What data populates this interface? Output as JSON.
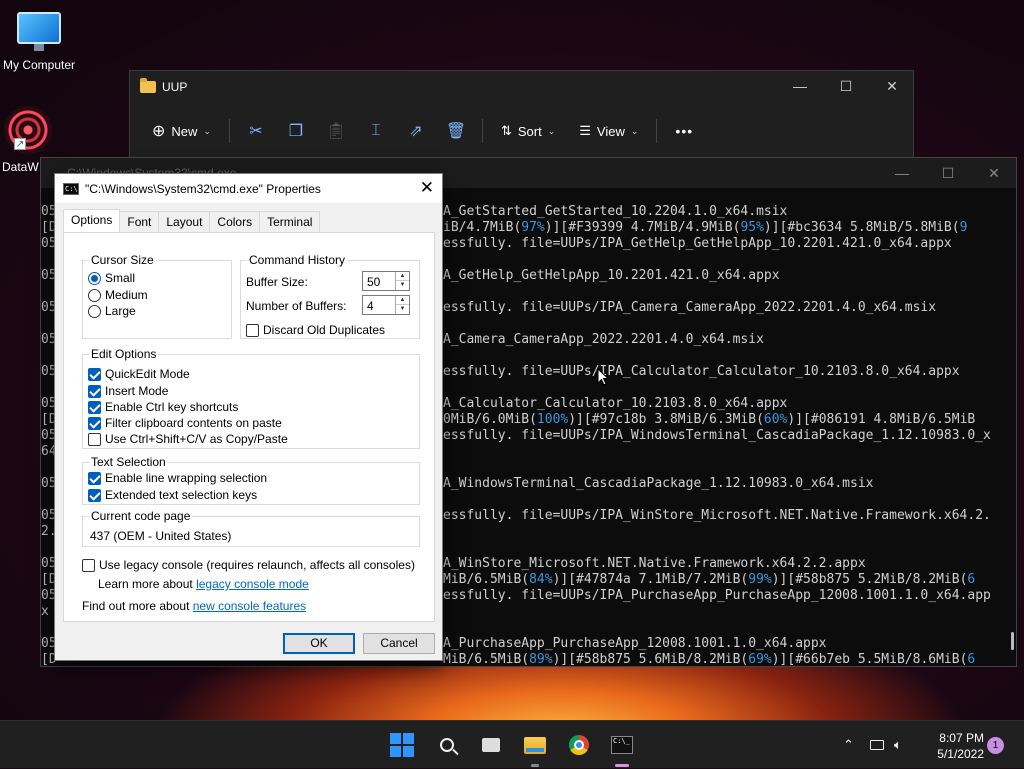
{
  "desktop": {
    "icons": [
      {
        "label": "My Computer",
        "icon": "monitor-icon"
      },
      {
        "label": "DataW",
        "icon": "datawave-icon"
      }
    ]
  },
  "explorer": {
    "title": "UUP",
    "toolbar": {
      "new_label": "New",
      "sort_label": "Sort",
      "view_label": "View",
      "icons": [
        "cut-icon",
        "copy-icon",
        "paste-icon",
        "rename-icon",
        "share-icon",
        "delete-icon"
      ],
      "more": "•••"
    }
  },
  "console": {
    "title": "C:\\Windows\\System32\\cmd.exe",
    "lines": [
      {
        "left": "05",
        "right": [
          {
            "t": "A_GetStarted_GetStarted_10.2204.1.0_x64.msix"
          }
        ]
      },
      {
        "left": "[D",
        "right": [
          {
            "t": "iB/4.7MiB("
          },
          {
            "t": "97%",
            "c": "cyan"
          },
          {
            "t": ")][#F39399 4.7MiB/4.9MiB("
          },
          {
            "t": "95%",
            "c": "cyan"
          },
          {
            "t": ")][#bc3634 5.8MiB/5.8MiB("
          },
          {
            "t": "9",
            "c": "cyan"
          }
        ]
      },
      {
        "left": "05",
        "right": [
          {
            "t": "essfully. file=UUPs/IPA_GetHelp_GetHelpApp_10.2201.421.0_x64.appx"
          }
        ]
      },
      {
        "left": "",
        "right": []
      },
      {
        "left": "05",
        "right": [
          {
            "t": "A_GetHelp_GetHelpApp_10.2201.421.0_x64.appx"
          }
        ]
      },
      {
        "left": "",
        "right": []
      },
      {
        "left": "05",
        "right": [
          {
            "t": "essfully. file=UUPs/IPA_Camera_CameraApp_2022.2201.4.0_x64.msix"
          }
        ]
      },
      {
        "left": "",
        "right": []
      },
      {
        "left": "05",
        "right": [
          {
            "t": "A_Camera_CameraApp_2022.2201.4.0_x64.msix"
          }
        ]
      },
      {
        "left": "",
        "right": []
      },
      {
        "left": "05",
        "right": [
          {
            "t": "essfully. file=UUPs/IPA_Calculator_Calculator_10.2103.8.0_x64.appx"
          }
        ]
      },
      {
        "left": "",
        "right": []
      },
      {
        "left": "05",
        "right": [
          {
            "t": "A_Calculator_Calculator_10.2103.8.0_x64.appx"
          }
        ]
      },
      {
        "left": "[D",
        "right": [
          {
            "t": "0MiB/6.0MiB("
          },
          {
            "t": "100%",
            "c": "cyan"
          },
          {
            "t": ")][#97c18b 3.8MiB/6.3MiB("
          },
          {
            "t": "60%",
            "c": "cyan"
          },
          {
            "t": ")][#086191 4.8MiB/6.5MiB"
          }
        ]
      },
      {
        "left": "05",
        "right": [
          {
            "t": "essfully. file=UUPs/IPA_WindowsTerminal_CascadiaPackage_1.12.10983.0_x"
          }
        ]
      },
      {
        "left": "64",
        "right": []
      },
      {
        "left": "",
        "right": []
      },
      {
        "left": "05",
        "right": [
          {
            "t": "A_WindowsTerminal_CascadiaPackage_1.12.10983.0_x64.msix"
          }
        ]
      },
      {
        "left": "",
        "right": []
      },
      {
        "left": "05",
        "right": [
          {
            "t": "essfully. file=UUPs/IPA_WinStore_Microsoft.NET.Native.Framework.x64.2."
          }
        ]
      },
      {
        "left": "2.",
        "right": []
      },
      {
        "left": "",
        "right": []
      },
      {
        "left": "05",
        "right": [
          {
            "t": "A_WinStore_Microsoft.NET.Native.Framework.x64.2.2.appx"
          }
        ]
      },
      {
        "left": "[D",
        "right": [
          {
            "t": "MiB/6.5MiB("
          },
          {
            "t": "84%",
            "c": "cyan"
          },
          {
            "t": ")][#47874a 7.1MiB/7.2MiB("
          },
          {
            "t": "99%",
            "c": "cyan"
          },
          {
            "t": ")][#58b875 5.2MiB/8.2MiB("
          },
          {
            "t": "6",
            "c": "cyan"
          }
        ]
      },
      {
        "left": "05",
        "right": [
          {
            "t": "essfully. file=UUPs/IPA_PurchaseApp_PurchaseApp_12008.1001.1.0_x64.app"
          }
        ]
      },
      {
        "left": "x",
        "right": []
      },
      {
        "left": "",
        "right": []
      },
      {
        "left": "05",
        "right": [
          {
            "t": "A_PurchaseApp_PurchaseApp_12008.1001.1.0_x64.appx"
          }
        ]
      },
      {
        "left": "[D",
        "right": [
          {
            "t": "MiB/6.5MiB("
          },
          {
            "t": "89%",
            "c": "cyan"
          },
          {
            "t": ")][#58b875 5.6MiB/8.2MiB("
          },
          {
            "t": "69%",
            "c": "cyan"
          },
          {
            "t": ")][#66b7eb 5.5MiB/8.6MiB("
          },
          {
            "t": "6",
            "c": "cyan"
          }
        ]
      }
    ]
  },
  "dialog": {
    "title": "\"C:\\Windows\\System32\\cmd.exe\" Properties",
    "tabs": [
      "Options",
      "Font",
      "Layout",
      "Colors",
      "Terminal"
    ],
    "cursor_size": {
      "legend": "Cursor Size",
      "options": [
        "Small",
        "Medium",
        "Large"
      ],
      "selected": "Small"
    },
    "command_history": {
      "legend": "Command History",
      "buffer_size_label": "Buffer Size:",
      "buffer_size": "50",
      "num_buffers_label": "Number of Buffers:",
      "num_buffers": "4",
      "discard_label": "Discard Old Duplicates"
    },
    "edit_options": {
      "legend": "Edit Options",
      "items": [
        {
          "label": "QuickEdit Mode",
          "checked": true
        },
        {
          "label": "Insert Mode",
          "checked": true
        },
        {
          "label": "Enable Ctrl key shortcuts",
          "checked": true
        },
        {
          "label": "Filter clipboard contents on paste",
          "checked": true
        },
        {
          "label": "Use Ctrl+Shift+C/V as Copy/Paste",
          "checked": false
        }
      ]
    },
    "text_selection": {
      "legend": "Text Selection",
      "items": [
        {
          "label": "Enable line wrapping selection",
          "checked": true
        },
        {
          "label": "Extended text selection keys",
          "checked": true
        }
      ]
    },
    "code_page": {
      "legend": "Current code page",
      "value": "437   (OEM - United States)"
    },
    "legacy_label": "Use legacy console (requires relaunch, affects all consoles)",
    "learn_more_prefix": "Learn more about ",
    "learn_more_link": "legacy console mode",
    "find_out_prefix": "Find out more about ",
    "find_out_link": "new console features",
    "ok_label": "OK",
    "cancel_label": "Cancel"
  },
  "taskbar": {
    "apps": [
      "start-icon",
      "search-icon",
      "task-view-icon",
      "file-explorer-icon",
      "chrome-icon",
      "terminal-icon"
    ],
    "time": "8:07 PM",
    "date": "5/1/2022",
    "notifications": "1"
  }
}
